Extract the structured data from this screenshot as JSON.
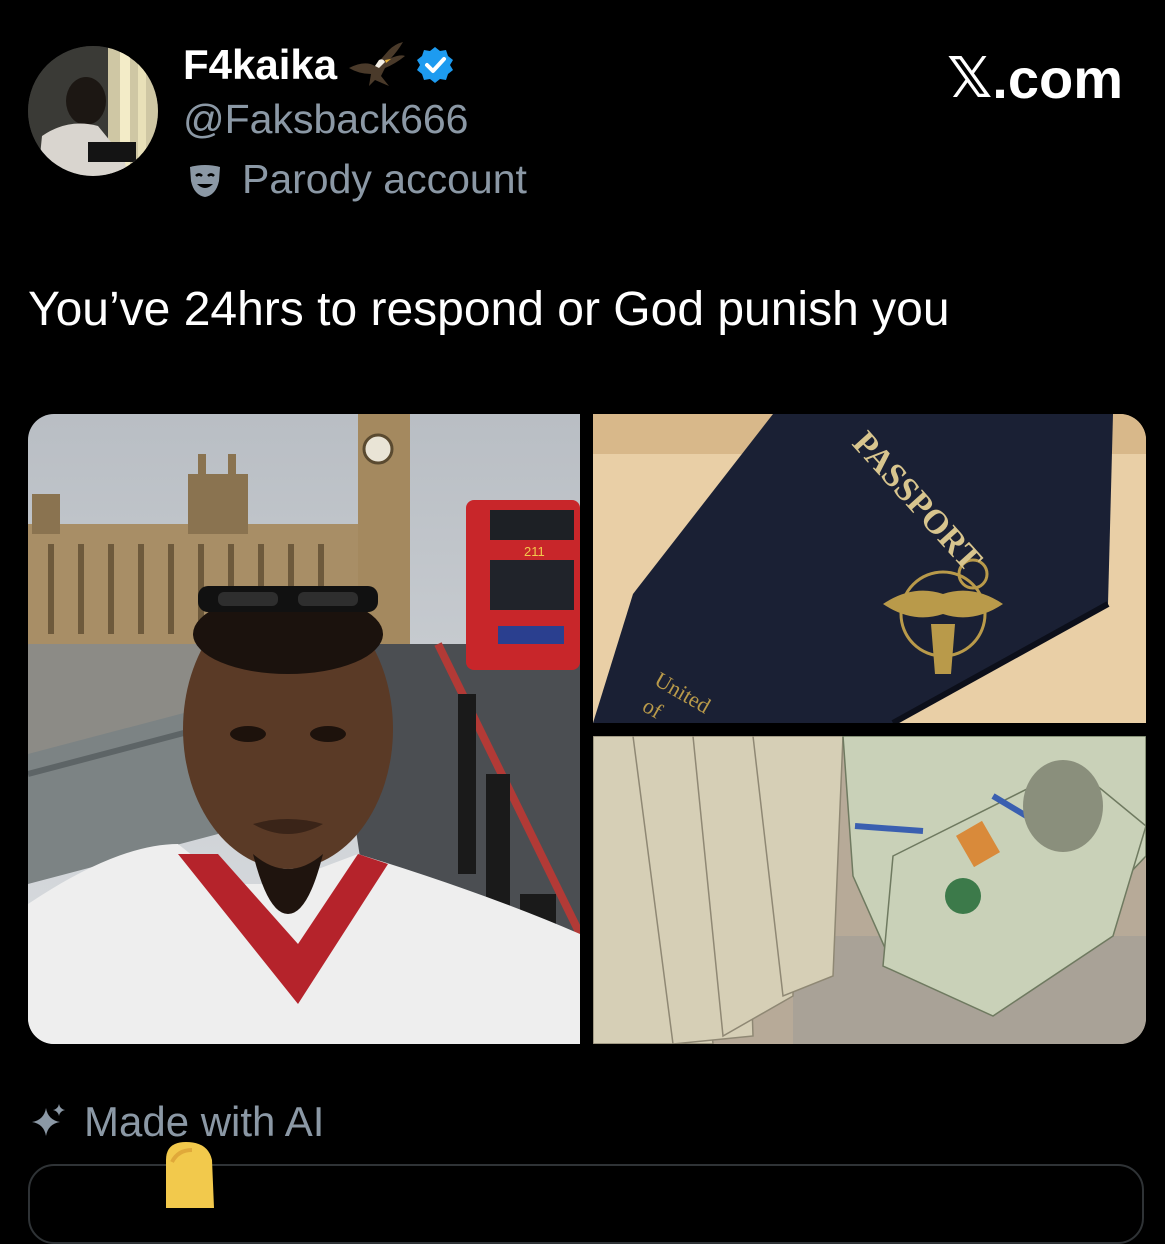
{
  "header": {
    "display_name": "F4kaika",
    "handle": "@Faksback666",
    "parody_label": "Parody account",
    "brand": "X.com",
    "brand_glyph": "𝕏",
    "brand_suffix": ".com"
  },
  "tweet": {
    "text": "You’ve 24hrs to respond or God punish you"
  },
  "media": {
    "bus_route": "211",
    "passport_title": "PASSPORT",
    "passport_bottom": "United",
    "passport_bottom2": "of"
  },
  "footer": {
    "ai_label": "Made with AI"
  },
  "icons": {
    "verified": "verified-badge-icon",
    "parody": "theater-mask-icon",
    "ai": "sparkle-icon",
    "eagle": "eagle-emoji-icon"
  },
  "colors": {
    "background": "#000000",
    "primary_text": "#ffffff",
    "secondary_text": "#8b98a5",
    "verified_blue": "#1d9bf0"
  }
}
